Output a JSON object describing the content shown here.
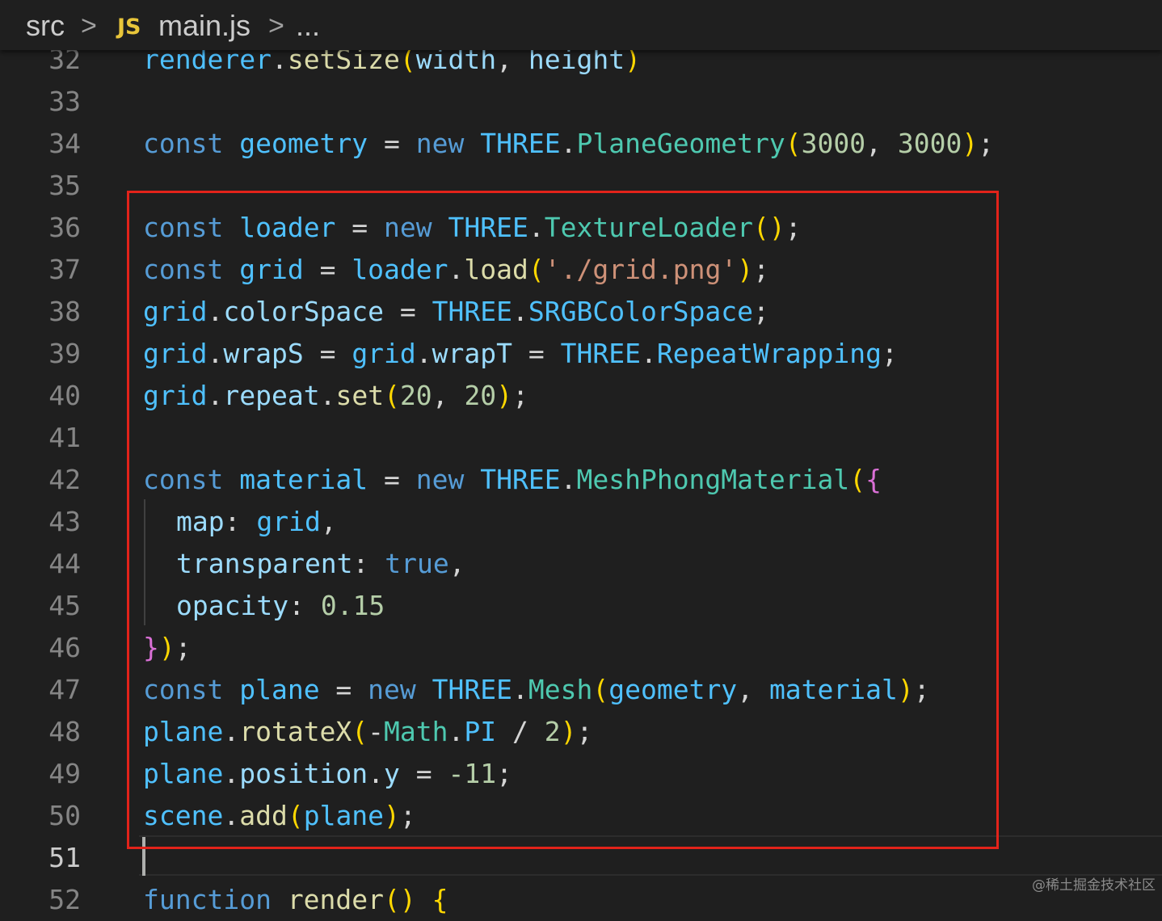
{
  "breadcrumb": {
    "folder": "src",
    "separator": ">",
    "file_icon": "JS",
    "file": "main.js",
    "more": "..."
  },
  "active_line": "51",
  "watermark": "@稀土掘金技术社区",
  "lines": [
    {
      "num": "32",
      "tokens": [
        [
          "renderer",
          "var"
        ],
        [
          ".",
          "op"
        ],
        [
          "setSize",
          "fn"
        ],
        [
          "(",
          "b1"
        ],
        [
          "width",
          "prop"
        ],
        [
          ", ",
          "op"
        ],
        [
          "height",
          "prop"
        ],
        [
          ")",
          "b1"
        ]
      ]
    },
    {
      "num": "33",
      "tokens": []
    },
    {
      "num": "34",
      "tokens": [
        [
          "const ",
          "kw"
        ],
        [
          "geometry",
          "var"
        ],
        [
          " = ",
          "op"
        ],
        [
          "new ",
          "kw"
        ],
        [
          "THREE",
          "var"
        ],
        [
          ".",
          "op"
        ],
        [
          "PlaneGeometry",
          "cls"
        ],
        [
          "(",
          "b1"
        ],
        [
          "3000",
          "num"
        ],
        [
          ", ",
          "op"
        ],
        [
          "3000",
          "num"
        ],
        [
          ")",
          "b1"
        ],
        [
          ";",
          "op"
        ]
      ]
    },
    {
      "num": "35",
      "tokens": []
    },
    {
      "num": "36",
      "tokens": [
        [
          "const ",
          "kw"
        ],
        [
          "loader",
          "var"
        ],
        [
          " = ",
          "op"
        ],
        [
          "new ",
          "kw"
        ],
        [
          "THREE",
          "var"
        ],
        [
          ".",
          "op"
        ],
        [
          "TextureLoader",
          "cls"
        ],
        [
          "()",
          "b1"
        ],
        [
          ";",
          "op"
        ]
      ]
    },
    {
      "num": "37",
      "tokens": [
        [
          "const ",
          "kw"
        ],
        [
          "grid",
          "var"
        ],
        [
          " = ",
          "op"
        ],
        [
          "loader",
          "var"
        ],
        [
          ".",
          "op"
        ],
        [
          "load",
          "fn"
        ],
        [
          "(",
          "b1"
        ],
        [
          "'./grid.png'",
          "str"
        ],
        [
          ")",
          "b1"
        ],
        [
          ";",
          "op"
        ]
      ]
    },
    {
      "num": "38",
      "tokens": [
        [
          "grid",
          "var"
        ],
        [
          ".",
          "op"
        ],
        [
          "colorSpace",
          "prop"
        ],
        [
          " = ",
          "op"
        ],
        [
          "THREE",
          "var"
        ],
        [
          ".",
          "op"
        ],
        [
          "SRGBColorSpace",
          "var"
        ],
        [
          ";",
          "op"
        ]
      ]
    },
    {
      "num": "39",
      "tokens": [
        [
          "grid",
          "var"
        ],
        [
          ".",
          "op"
        ],
        [
          "wrapS",
          "prop"
        ],
        [
          " = ",
          "op"
        ],
        [
          "grid",
          "var"
        ],
        [
          ".",
          "op"
        ],
        [
          "wrapT",
          "prop"
        ],
        [
          " = ",
          "op"
        ],
        [
          "THREE",
          "var"
        ],
        [
          ".",
          "op"
        ],
        [
          "RepeatWrapping",
          "var"
        ],
        [
          ";",
          "op"
        ]
      ]
    },
    {
      "num": "40",
      "tokens": [
        [
          "grid",
          "var"
        ],
        [
          ".",
          "op"
        ],
        [
          "repeat",
          "prop"
        ],
        [
          ".",
          "op"
        ],
        [
          "set",
          "fn"
        ],
        [
          "(",
          "b1"
        ],
        [
          "20",
          "num"
        ],
        [
          ", ",
          "op"
        ],
        [
          "20",
          "num"
        ],
        [
          ")",
          "b1"
        ],
        [
          ";",
          "op"
        ]
      ]
    },
    {
      "num": "41",
      "tokens": []
    },
    {
      "num": "42",
      "tokens": [
        [
          "const ",
          "kw"
        ],
        [
          "material",
          "var"
        ],
        [
          " = ",
          "op"
        ],
        [
          "new ",
          "kw"
        ],
        [
          "THREE",
          "var"
        ],
        [
          ".",
          "op"
        ],
        [
          "MeshPhongMaterial",
          "cls"
        ],
        [
          "(",
          "b1"
        ],
        [
          "{",
          "b2"
        ]
      ]
    },
    {
      "num": "43",
      "indent": true,
      "tokens": [
        [
          "map",
          "prop"
        ],
        [
          ": ",
          "op"
        ],
        [
          "grid",
          "var"
        ],
        [
          ",",
          "op"
        ]
      ]
    },
    {
      "num": "44",
      "indent": true,
      "tokens": [
        [
          "transparent",
          "prop"
        ],
        [
          ": ",
          "op"
        ],
        [
          "true",
          "kw"
        ],
        [
          ",",
          "op"
        ]
      ]
    },
    {
      "num": "45",
      "indent": true,
      "tokens": [
        [
          "opacity",
          "prop"
        ],
        [
          ": ",
          "op"
        ],
        [
          "0.15",
          "num"
        ]
      ]
    },
    {
      "num": "46",
      "tokens": [
        [
          "}",
          "b2"
        ],
        [
          ")",
          "b1"
        ],
        [
          ";",
          "op"
        ]
      ]
    },
    {
      "num": "47",
      "tokens": [
        [
          "const ",
          "kw"
        ],
        [
          "plane",
          "var"
        ],
        [
          " = ",
          "op"
        ],
        [
          "new ",
          "kw"
        ],
        [
          "THREE",
          "var"
        ],
        [
          ".",
          "op"
        ],
        [
          "Mesh",
          "cls"
        ],
        [
          "(",
          "b1"
        ],
        [
          "geometry",
          "var"
        ],
        [
          ", ",
          "op"
        ],
        [
          "material",
          "var"
        ],
        [
          ")",
          "b1"
        ],
        [
          ";",
          "op"
        ]
      ]
    },
    {
      "num": "48",
      "tokens": [
        [
          "plane",
          "var"
        ],
        [
          ".",
          "op"
        ],
        [
          "rotateX",
          "fn"
        ],
        [
          "(",
          "b1"
        ],
        [
          "-",
          "op"
        ],
        [
          "Math",
          "cls"
        ],
        [
          ".",
          "op"
        ],
        [
          "PI",
          "var"
        ],
        [
          " / ",
          "op"
        ],
        [
          "2",
          "num"
        ],
        [
          ")",
          "b1"
        ],
        [
          ";",
          "op"
        ]
      ]
    },
    {
      "num": "49",
      "tokens": [
        [
          "plane",
          "var"
        ],
        [
          ".",
          "op"
        ],
        [
          "position",
          "prop"
        ],
        [
          ".",
          "op"
        ],
        [
          "y",
          "prop"
        ],
        [
          " = ",
          "op"
        ],
        [
          "-11",
          "num"
        ],
        [
          ";",
          "op"
        ]
      ]
    },
    {
      "num": "50",
      "tokens": [
        [
          "scene",
          "var"
        ],
        [
          ".",
          "op"
        ],
        [
          "add",
          "fn"
        ],
        [
          "(",
          "b1"
        ],
        [
          "plane",
          "var"
        ],
        [
          ")",
          "b1"
        ],
        [
          ";",
          "op"
        ]
      ]
    },
    {
      "num": "51",
      "tokens": []
    },
    {
      "num": "52",
      "tokens": [
        [
          "function ",
          "kw"
        ],
        [
          "render",
          "fn"
        ],
        [
          "() ",
          "b1"
        ],
        [
          "{",
          "b1"
        ]
      ]
    }
  ]
}
